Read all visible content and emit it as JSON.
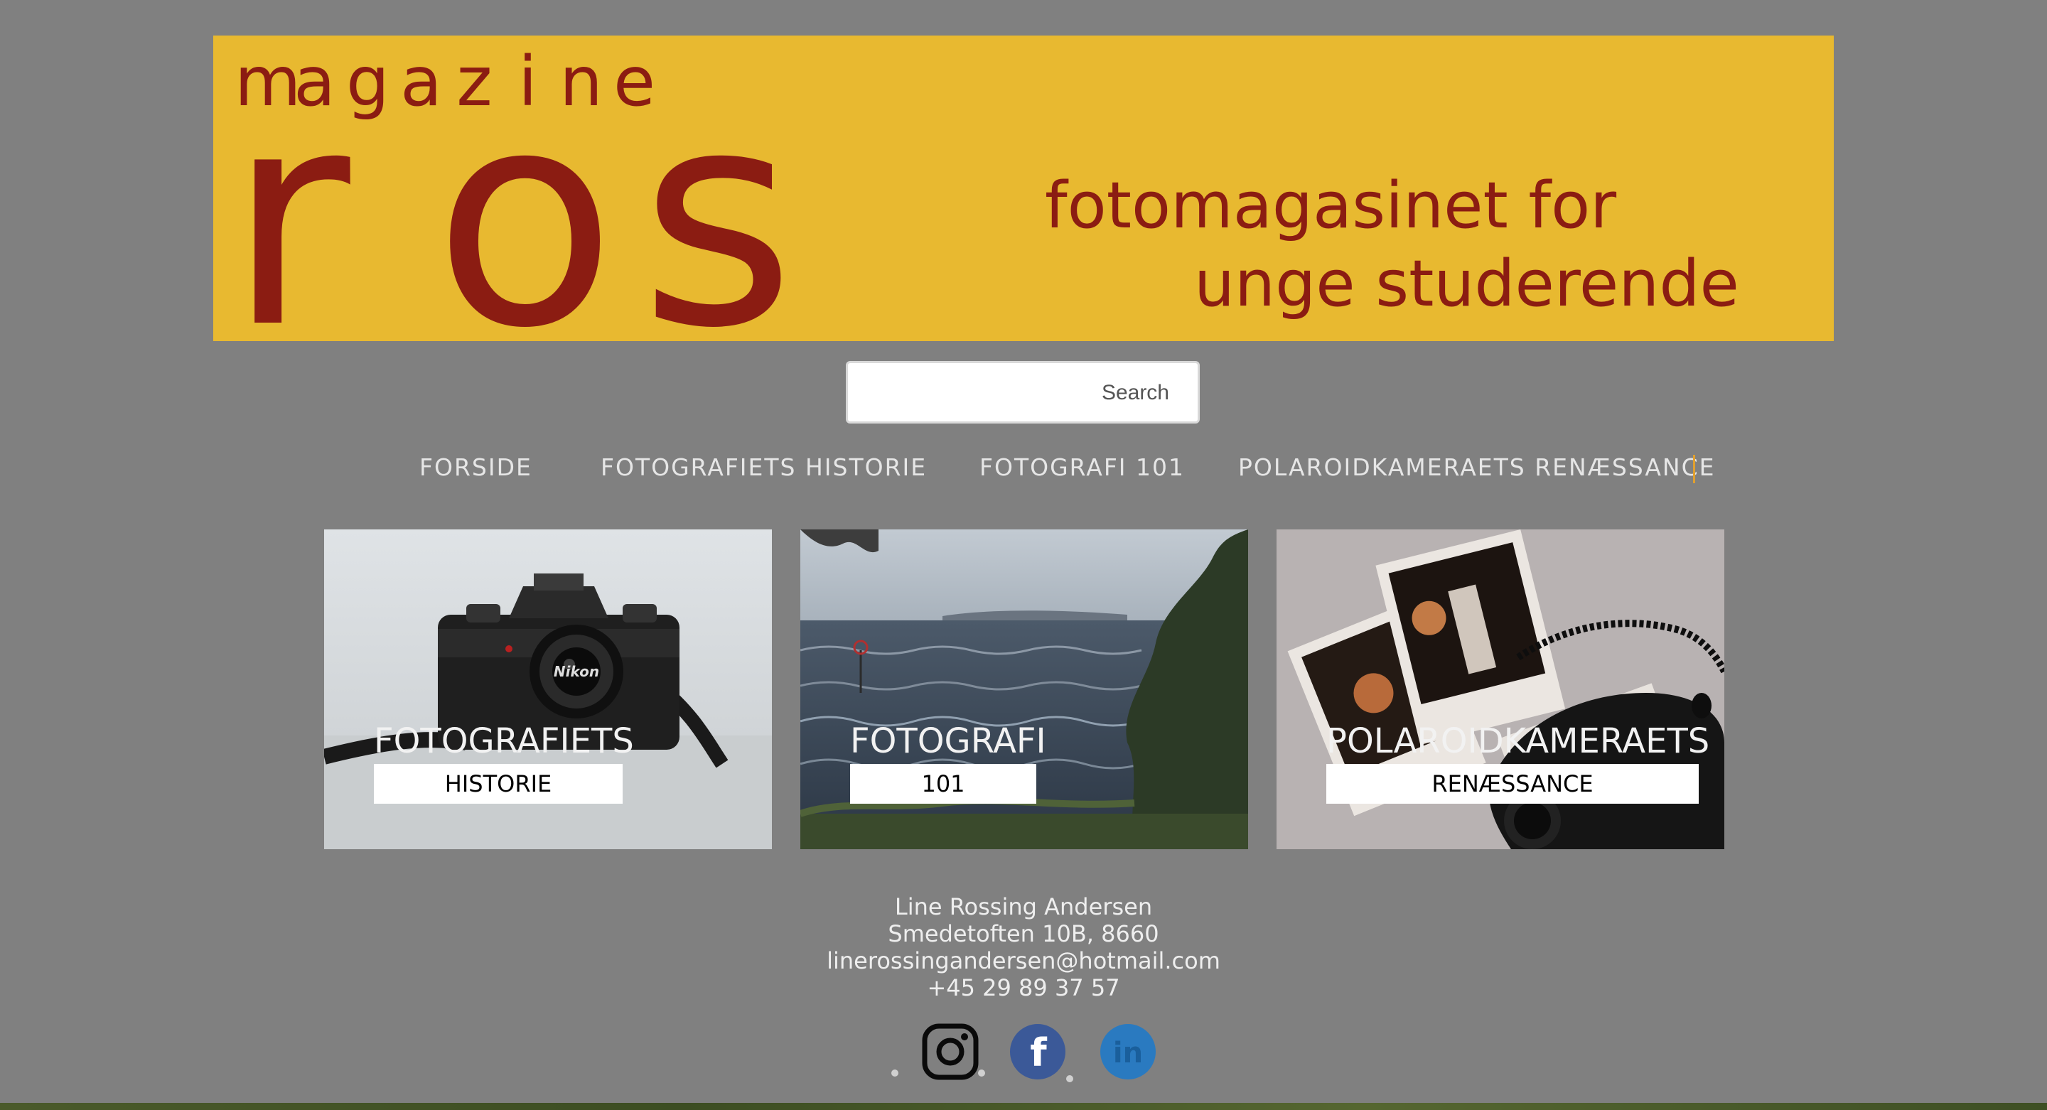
{
  "banner": {
    "magazine_letters": [
      "m",
      "a",
      "g",
      "a",
      "z",
      "i",
      "n",
      "e"
    ],
    "logo_letters": [
      "r",
      "o",
      "s"
    ],
    "tagline_line1": "fotomagasinet for",
    "tagline_line2": "unge studerende",
    "background_color": "#e8b930",
    "text_color": "#8b1c12"
  },
  "search": {
    "value": "",
    "button_label": "Search"
  },
  "nav": {
    "items": [
      {
        "label": "FORSIDE"
      },
      {
        "label": "FOTOGRAFIETS HISTORIE"
      },
      {
        "label": "FOTOGRAFI 101"
      },
      {
        "label": "POLAROIDKAMERAETS RENÆSSANCE"
      }
    ]
  },
  "cards": [
    {
      "title": "FOTOGRAFIETS",
      "label": "HISTORIE",
      "image": "nikon-camera-photo"
    },
    {
      "title": "FOTOGRAFI",
      "label": "101",
      "image": "stormy-sea-photo"
    },
    {
      "title": "POLAROIDKAMERAETS",
      "label": "RENÆSSANCE",
      "image": "polaroid-camera-photo"
    }
  ],
  "footer": {
    "name": "Line Rossing Andersen",
    "address": "Smedetoften 10B, 8660",
    "email": "linerossingandersen@hotmail.com",
    "phone": "+45 29 89 37 57"
  },
  "social": [
    {
      "icon": "instagram-icon"
    },
    {
      "icon": "facebook-icon",
      "color": "#3b5998"
    },
    {
      "icon": "linkedin-icon",
      "color": "#2a7ac0"
    }
  ],
  "colors": {
    "page_background": "#808080",
    "nav_text": "#e6e6e6"
  }
}
